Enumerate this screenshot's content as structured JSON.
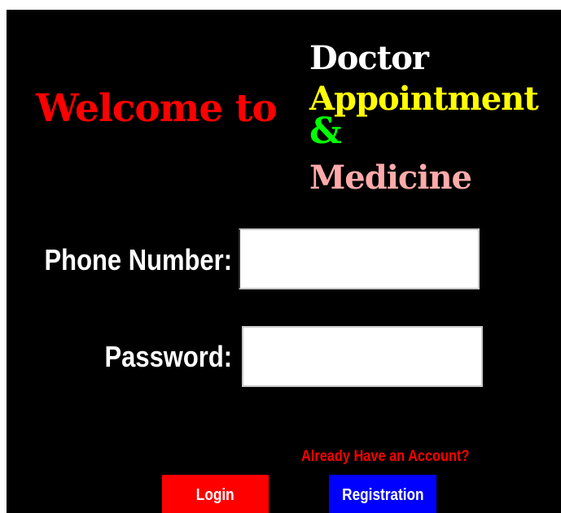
{
  "header": {
    "welcome": "Welcome to",
    "title_line1": "Doctor",
    "title_line2": "Appointment",
    "title_line3": "&",
    "title_line4": "Medicine"
  },
  "form": {
    "phone_label": "Phone Number:",
    "phone_value": "",
    "password_label": "Password:",
    "password_value": ""
  },
  "links": {
    "account": "Already Have an Account?"
  },
  "buttons": {
    "login": "Login",
    "registration": "Registration"
  },
  "colors": {
    "background": "#000000",
    "welcome": "#ff0000",
    "doctor": "#ffffff",
    "appointment": "#ffff00",
    "ampersand": "#00ff00",
    "medicine": "#ffaaaa",
    "account_link": "#ff0000",
    "login_button": "#ff0000",
    "registration_button": "#0000ff"
  }
}
